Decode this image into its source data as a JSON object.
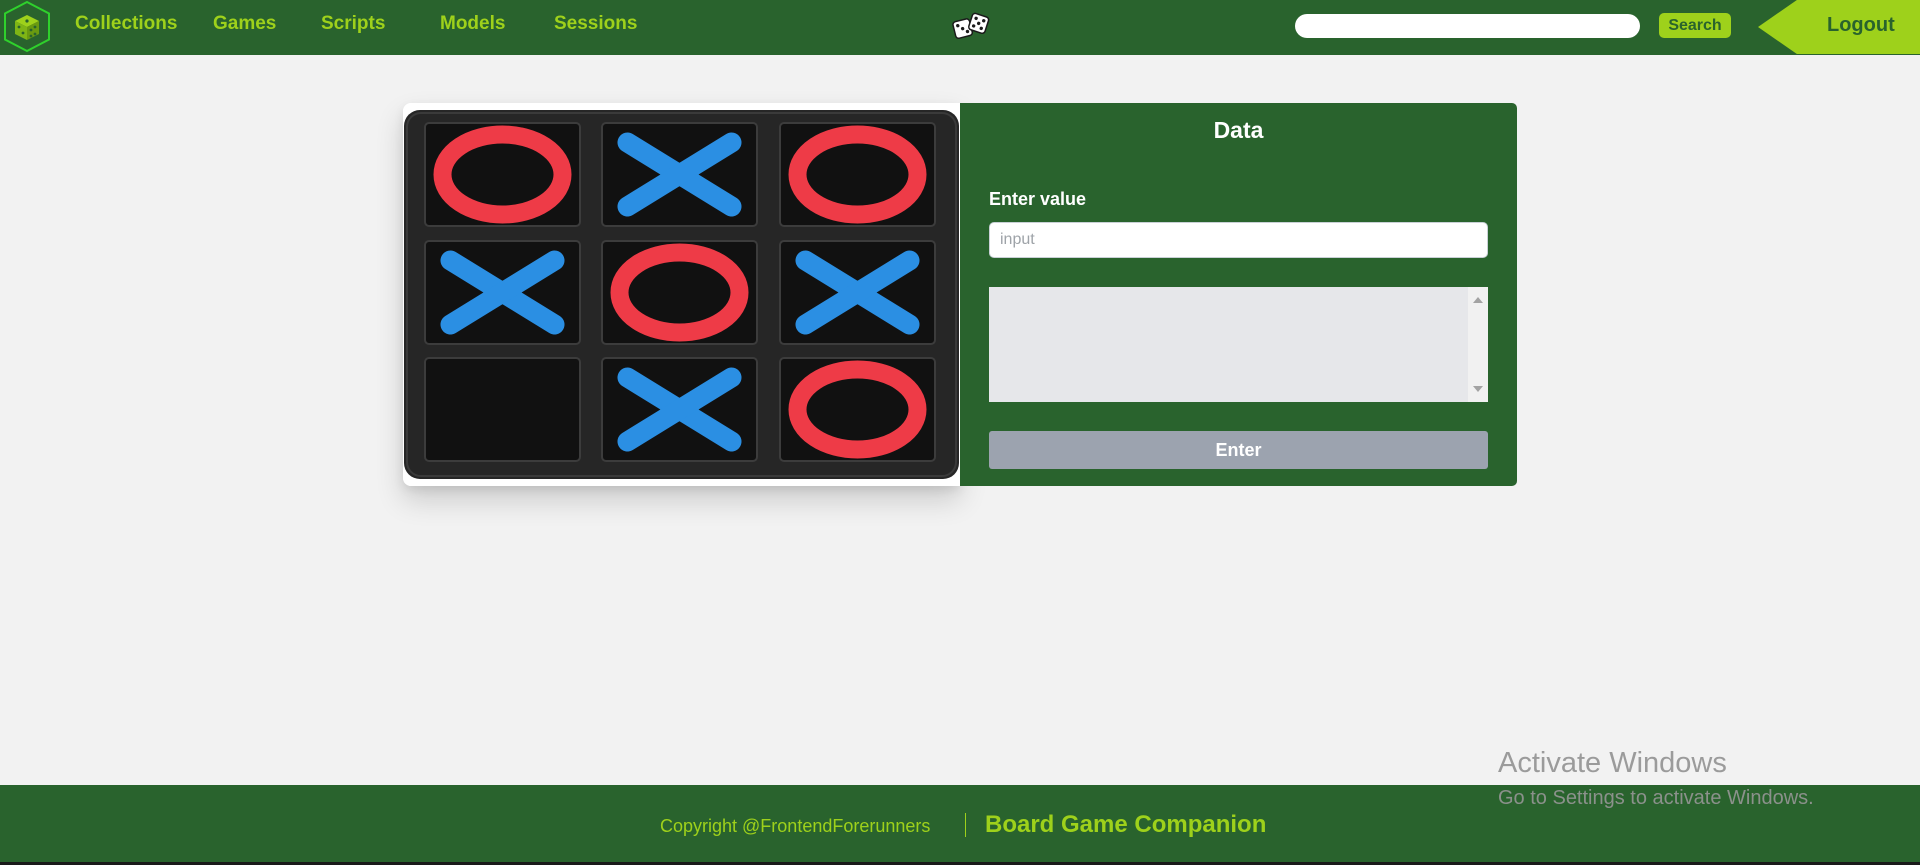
{
  "nav": {
    "links": [
      "Collections",
      "Games",
      "Scripts",
      "Models",
      "Sessions"
    ],
    "search": {
      "placeholder": "",
      "button_label": "Search"
    },
    "logout_label": "Logout"
  },
  "game_image": {
    "board": [
      [
        "O",
        "X",
        "O"
      ],
      [
        "X",
        "O",
        "X"
      ],
      [
        "",
        "X",
        "O"
      ]
    ]
  },
  "data_panel": {
    "title": "Data",
    "field_label": "Enter value",
    "input_placeholder": "input",
    "input_value": "",
    "output_text": "",
    "enter_label": "Enter"
  },
  "footer": {
    "copyright": "Copyright @FrontendForerunners",
    "brand": "Board Game Companion"
  },
  "watermark": {
    "title": "Activate Windows",
    "subtitle": "Go to Settings to activate Windows."
  },
  "colors": {
    "nav_bg": "#29632d",
    "accent": "#9ed11b",
    "page_bg": "#f2f2f2",
    "o_piece": "#ee3b47",
    "x_piece": "#2b8fe3",
    "button_disabled": "#9ca3af"
  }
}
